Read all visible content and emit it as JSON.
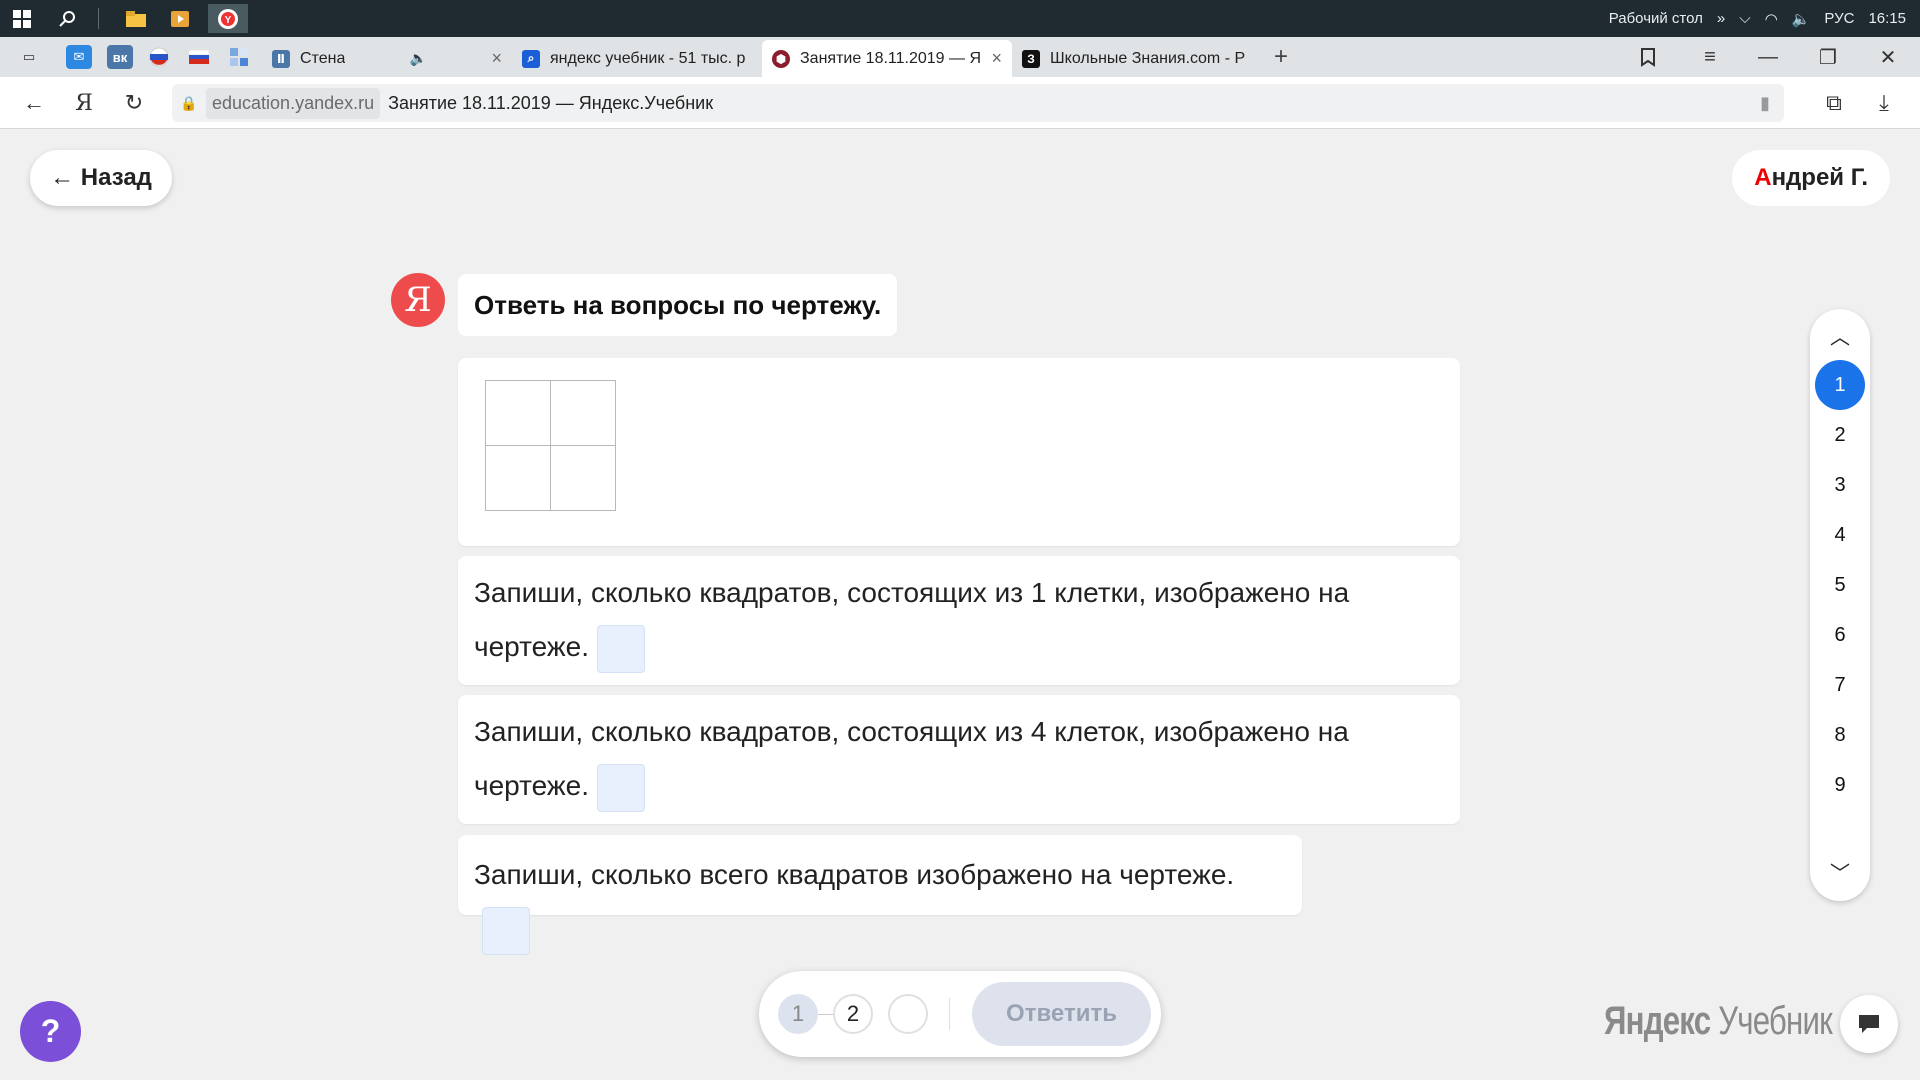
{
  "taskbar": {
    "tray_desktop": "Рабочий стол",
    "tray_lang": "РУС",
    "tray_time": "16:15"
  },
  "tabs": [
    {
      "title": "Стена"
    },
    {
      "title": "яндекс учебник - 51 тыс. р"
    },
    {
      "title": "Занятие 18.11.2019 — Я"
    },
    {
      "title": "Школьные Знания.com - Р"
    }
  ],
  "address": {
    "domain": "education.yandex.ru",
    "title": "Занятие 18.11.2019 — Яндекс.Учебник"
  },
  "page": {
    "back_label": "← Назад",
    "user_first_letter": "А",
    "user_rest": "ндрей Г.",
    "avatar_letter": "Я",
    "instruction": "Ответь на вопросы по чертежу.",
    "questions": [
      "Запиши, сколько квадратов, состоящих из 1 клетки, изображено на чертеже.",
      "Запиши, сколько квадратов, состоящих из 4 клеток, изображено на чертеже.",
      "Запиши, сколько всего квадратов изображено на чертеже."
    ],
    "nav_numbers": [
      "1",
      "2",
      "3",
      "4",
      "5",
      "6",
      "7",
      "8",
      "9"
    ],
    "current_question": 1,
    "steps": [
      "1",
      "2",
      ""
    ],
    "submit_label": "Ответить",
    "brand_bold": "Яндекс",
    "brand_light": " Учебник",
    "help_label": "?"
  },
  "icons": {
    "back": "arrow-left-icon",
    "reload": "reload-icon",
    "lock": "lock-icon",
    "chat": "chat-icon"
  }
}
